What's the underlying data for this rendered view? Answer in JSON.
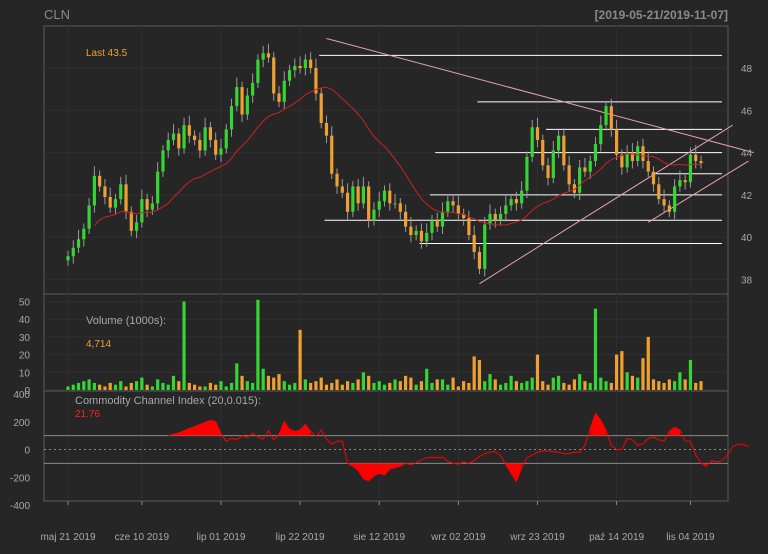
{
  "title": "CLN",
  "date_range": "[2019-05-21/2019-11-07]",
  "colors": {
    "background": "#262626",
    "up": "#33d633",
    "down": "#f0a030",
    "ma": "#cc2222",
    "trendline": "#e8a0b8",
    "hline": "#ffffff",
    "cci": "#ff0000",
    "text": "#a8a8a8",
    "last_price": "#f0a030"
  },
  "x_tick_labels": [
    "maj 21 2019",
    "cze 10 2019",
    "lip 01 2019",
    "lip 22 2019",
    "sie 12 2019",
    "wrz 02 2019",
    "wrz 23 2019",
    "paź 14 2019",
    "lis 04 2019"
  ],
  "price_panel": {
    "last_label": "Last 43.5",
    "y_ticks": [
      "38",
      "40",
      "42",
      "44",
      "46",
      "48"
    ]
  },
  "volume_panel": {
    "label": "Volume (1000s):",
    "last_value": "4,714",
    "y_ticks": [
      "0",
      "10",
      "20",
      "30",
      "40",
      "50"
    ]
  },
  "cci_panel": {
    "label": "Commodity Channel Index (20,0.015):",
    "last_value": "21.76",
    "y_ticks": [
      "-400",
      "-200",
      "0",
      "200",
      "400"
    ]
  },
  "chart_data": [
    {
      "type": "candlestick",
      "name": "price",
      "ylim": [
        37.5,
        49.8
      ],
      "close": [
        39.1,
        39.5,
        39.9,
        40.4,
        41.5,
        42.9,
        42.4,
        41.9,
        41.4,
        41.8,
        42.5,
        41.2,
        40.3,
        40.7,
        41.8,
        41.3,
        41.6,
        43.1,
        44.1,
        44.6,
        44.9,
        44.2,
        45.3,
        44.8,
        44.6,
        44.1,
        45.2,
        44.6,
        43.9,
        44.2,
        45.1,
        46.2,
        47.1,
        45.8,
        46.7,
        47.3,
        48.4,
        48.7,
        48.5,
        46.8,
        46.4,
        47.4,
        47.9,
        48.1,
        48.0,
        48.4,
        48.0,
        46.8,
        45.4,
        44.8,
        43.0,
        42.4,
        42.1,
        41.2,
        42.4,
        41.6,
        42.4,
        40.8,
        41.3,
        41.7,
        42.2,
        41.6,
        41.6,
        41.2,
        40.5,
        40.1,
        40.3,
        39.8,
        40.2,
        40.8,
        40.5,
        41.2,
        41.7,
        41.5,
        41.1,
        40.9,
        40.1,
        39.3,
        38.5,
        40.6,
        41.1,
        40.8,
        41.1,
        41.5,
        41.8,
        41.6,
        42.2,
        43.8,
        45.2,
        44.6,
        43.4,
        42.8,
        44.1,
        44.8,
        43.4,
        42.5,
        42.1,
        43.3,
        43.1,
        43.6,
        44.4,
        45.3,
        46.2,
        45.1,
        43.9,
        43.3,
        44.0,
        43.6,
        44.3,
        43.6,
        43.1,
        42.5,
        41.8,
        41.5,
        41.2,
        42.4,
        42.7,
        42.6,
        43.9,
        43.6,
        43.5
      ],
      "ma_window": 20,
      "horizontal_levels": [
        48.6,
        46.4,
        45.1,
        44.0,
        43.0,
        42.0,
        40.8,
        39.7
      ],
      "trendlines": [
        {
          "x": [
            49,
            130
          ],
          "y": [
            49.4,
            44.0
          ]
        },
        {
          "x": [
            78,
            126
          ],
          "y": [
            37.8,
            45.3
          ]
        },
        {
          "x": [
            110,
            129
          ],
          "y": [
            40.7,
            43.6
          ]
        }
      ]
    },
    {
      "type": "bar",
      "name": "volume",
      "ylim": [
        0,
        52
      ],
      "values": [
        2,
        3,
        4,
        5,
        6,
        4,
        3,
        2,
        4,
        3,
        5,
        2,
        4,
        5,
        7,
        3,
        2,
        6,
        4,
        3,
        8,
        5,
        50,
        4,
        3,
        2,
        2,
        4,
        3,
        5,
        2,
        4,
        15,
        8,
        5,
        4,
        51,
        12,
        8,
        7,
        9,
        5,
        3,
        4,
        34,
        6,
        4,
        5,
        7,
        3,
        4,
        6,
        3,
        5,
        4,
        6,
        10,
        8,
        4,
        5,
        3,
        4,
        6,
        5,
        8,
        7,
        3,
        5,
        12,
        4,
        6,
        6,
        3,
        7,
        2,
        5,
        4,
        19,
        17,
        5,
        9,
        6,
        3,
        4,
        8,
        5,
        4,
        5,
        7,
        20,
        5,
        3,
        7,
        8,
        4,
        3,
        6,
        9,
        5,
        4,
        46,
        7,
        5,
        4,
        20,
        22,
        10,
        8,
        7,
        18,
        30,
        6,
        5,
        4,
        6,
        5,
        10,
        6,
        17,
        4,
        5
      ]
    },
    {
      "type": "line",
      "name": "cci",
      "ylim": [
        -400,
        400
      ],
      "reference_lines": [
        100,
        0,
        -100
      ],
      "values": [
        null,
        null,
        null,
        null,
        null,
        null,
        null,
        null,
        null,
        null,
        null,
        null,
        null,
        null,
        null,
        null,
        null,
        null,
        null,
        100,
        110,
        120,
        135,
        150,
        165,
        180,
        195,
        210,
        200,
        115,
        60,
        80,
        70,
        100,
        85,
        120,
        90,
        75,
        135,
        70,
        110,
        200,
        145,
        130,
        140,
        180,
        130,
        95,
        140,
        75,
        40,
        60,
        60,
        -100,
        -120,
        -150,
        -210,
        -225,
        -190,
        -170,
        -185,
        -140,
        -130,
        -120,
        -100,
        -110,
        -95,
        -75,
        -60,
        -55,
        -60,
        -55,
        -85,
        -100,
        -105,
        -90,
        -100,
        -80,
        -50,
        -30,
        -20,
        -15,
        -45,
        -110,
        -170,
        -230,
        -130,
        -60,
        -40,
        -20,
        -10,
        -10,
        -15,
        -20,
        -30,
        -30,
        -20,
        -20,
        30,
        150,
        260,
        210,
        140,
        30,
        0,
        0,
        80,
        70,
        30,
        40,
        80,
        90,
        70,
        60,
        130,
        160,
        140,
        60,
        60,
        -40,
        -100,
        -120,
        -80,
        -90,
        -80,
        -40,
        20,
        40,
        35,
        21.76
      ]
    }
  ]
}
